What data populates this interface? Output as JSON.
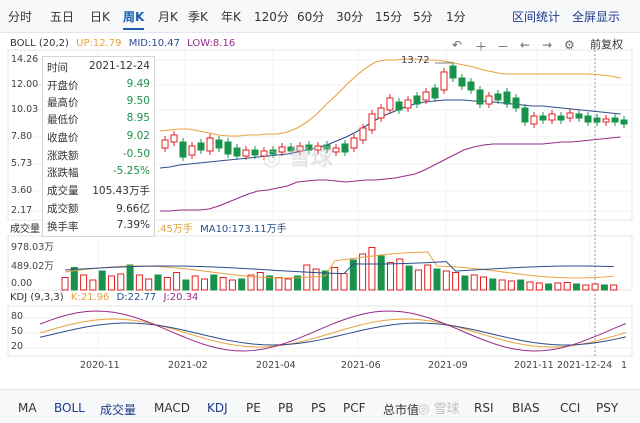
{
  "period_tabs": [
    {
      "label": "分时",
      "active": false
    },
    {
      "label": "五日",
      "active": false
    },
    {
      "label": "日K",
      "active": false
    },
    {
      "label": "周K",
      "active": true
    },
    {
      "label": "月K",
      "active": false
    },
    {
      "label": "季K",
      "active": false
    },
    {
      "label": "年K",
      "active": false
    },
    {
      "label": "120分",
      "active": false
    },
    {
      "label": "60分",
      "active": false
    },
    {
      "label": "30分",
      "active": false
    },
    {
      "label": "15分",
      "active": false
    },
    {
      "label": "5分",
      "active": false
    },
    {
      "label": "1分",
      "active": false
    }
  ],
  "top_right": {
    "interval_stats": "区间统计",
    "fullscreen": "全屏显示"
  },
  "boll_legend": {
    "name": "BOLL (20,2)",
    "up": "UP:12.79",
    "mid": "MID:10.47",
    "low": "LOW:8.16"
  },
  "price_toolbar": {
    "fuquan": "前复权"
  },
  "price_axis": [
    "14.26",
    "12.00",
    "10.03",
    "7.80",
    "5.73",
    "3.60",
    "2.17"
  ],
  "peak_label": "13.72",
  "tooltip": {
    "rows": [
      {
        "k": "时间",
        "v": "2021-12-24",
        "c": "dark"
      },
      {
        "k": "开盘价",
        "v": "9.49",
        "c": "green"
      },
      {
        "k": "最高价",
        "v": "9.50",
        "c": "green"
      },
      {
        "k": "最低价",
        "v": "8.95",
        "c": "green"
      },
      {
        "k": "收盘价",
        "v": "9.02",
        "c": "green"
      },
      {
        "k": "涨跌额",
        "v": "-0.50",
        "c": "green"
      },
      {
        "k": "涨跌幅",
        "v": "-5.25%",
        "c": "green"
      },
      {
        "k": "成交量",
        "v": "105.43万手",
        "c": "dark"
      },
      {
        "k": "成交额",
        "v": "9.66亿",
        "c": "dark"
      },
      {
        "k": "换手率",
        "v": "7.39%",
        "c": "dark"
      }
    ]
  },
  "volume_legend": {
    "name": "成交量",
    "ma5_tail": ".45万手",
    "ma10": "MA10:173.11万手"
  },
  "volume_axis": [
    "978.03万",
    "489.02万",
    "0.00"
  ],
  "kdj_legend": {
    "name": "KDJ (9,3,3)",
    "k": "K:21.96",
    "d": "D:22.77",
    "j": "J:20.34"
  },
  "kdj_axis": [
    "80",
    "50",
    "20"
  ],
  "date_axis": [
    "2020-11",
    "2021-02",
    "2021-04",
    "2021-06",
    "2021-09",
    "2021-11",
    "2021-12-24",
    "1"
  ],
  "bottom_tabs": [
    {
      "label": "MA",
      "active": false
    },
    {
      "label": "BOLL",
      "active": true
    },
    {
      "label": "成交量",
      "active": true
    },
    {
      "label": "MACD",
      "active": false
    },
    {
      "label": "KDJ",
      "active": true
    },
    {
      "label": "PE",
      "active": false
    },
    {
      "label": "PB",
      "active": false
    },
    {
      "label": "PS",
      "active": false
    },
    {
      "label": "PCF",
      "active": false
    },
    {
      "label": "总市值",
      "active": false
    },
    {
      "label": "RSI",
      "active": false
    },
    {
      "label": "BIAS",
      "active": false
    },
    {
      "label": "CCI",
      "active": false
    },
    {
      "label": "PSY",
      "active": false
    }
  ],
  "colors": {
    "up": "#e02020",
    "down": "#19934b",
    "boll_up": "#e8a33c",
    "boll_mid": "#2a4f8a",
    "boll_low": "#9a2a8a",
    "accent": "#1a5fb4"
  }
}
